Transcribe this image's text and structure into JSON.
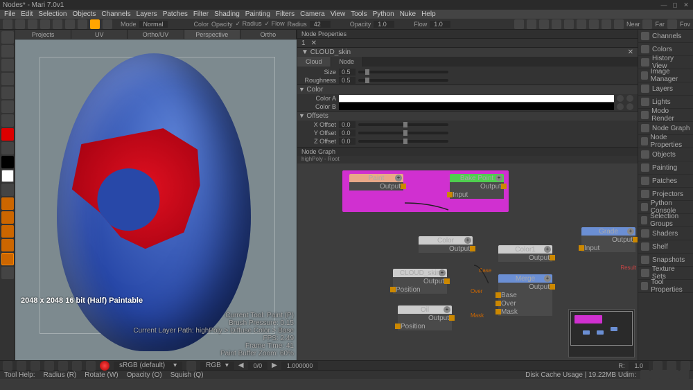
{
  "title": "Nodes* - Mari 7.0v1",
  "menu": [
    "File",
    "Edit",
    "Selection",
    "Objects",
    "Channels",
    "Layers",
    "Patches",
    "Filter",
    "Shading",
    "Painting",
    "Filters",
    "Camera",
    "View",
    "Tools",
    "Python",
    "Nuke",
    "Help"
  ],
  "toolbar": {
    "mode_lbl": "Mode",
    "mode_val": "Normal",
    "color_lbl": "Color",
    "opacity_lbl": "Opacity",
    "radius_chk": "✓ Radius",
    "flow_chk": "✓ Flow",
    "radius": "Radius",
    "radius_val": "42",
    "opacity2": "Opacity",
    "opacity2_val": "1.0",
    "flow": "Flow",
    "flow_val": "1.0",
    "near": "Near",
    "far": "Far",
    "fov": "Fov"
  },
  "viewport_tabs": [
    "Projects",
    "UV",
    "Ortho/UV",
    "Perspective",
    "Ortho"
  ],
  "viewport_tabs_active": 3,
  "viewport_overlay": "2048 x 2048 16 bit (Half) Paintable",
  "viewport_info": [
    "Current Tool: Paint (P)",
    "Brush Pressure: 0.15",
    "Current Layer Path: highPoly > Diffuse Color > Base",
    "FPS: 2.49",
    "Frame Time: 41",
    "Paint Buffer Zoom: 60%"
  ],
  "node_props": {
    "title": "Node Properties",
    "section": "CLOUD_skin",
    "tabs": [
      "Cloud",
      "Node"
    ],
    "size_lbl": "Size",
    "size_val": "0.5",
    "rough_lbl": "Roughness",
    "rough_val": "0.5",
    "color_grp": "Color",
    "colorA": "Color A",
    "colorB": "Color B",
    "offsets_grp": "Offsets",
    "xoff": "X Offset",
    "xoff_val": "0.0",
    "yoff": "Y Offset",
    "yoff_val": "0.0",
    "zoff": "Z Offset",
    "zoff_val": "0.0"
  },
  "nodegraph": {
    "title": "Node Graph",
    "path": "highPoly - Root",
    "nodes": {
      "paint": "Paint",
      "bake": "Bake Point",
      "color": "Color",
      "color1": "Color1",
      "cloud": "CLOUD_skin",
      "oil": "Oil",
      "merge": "Merge",
      "grade": "Grade",
      "output": "Output",
      "input": "Input",
      "position": "Position",
      "base": "Base",
      "over": "Over",
      "mask": "Mask",
      "result": "Result"
    }
  },
  "rpanel": [
    "Channels",
    "Colors",
    "History View",
    "Image Manager",
    "Layers",
    "Lights",
    "Modo Render",
    "Node Graph",
    "Node Properties",
    "Objects",
    "Painting",
    "Patches",
    "Projectors",
    "Python Console",
    "Selection Groups",
    "Shaders",
    "Shelf",
    "Snapshots",
    "Texture Sets",
    "Tool Properties"
  ],
  "bottombar": {
    "cs": "sRGB (default)",
    "ch": "RGB",
    "fr": "0/0",
    "zoom": "1.000000",
    "r": "1.0"
  },
  "statusbar": {
    "help": "Tool Help:",
    "radius": "Radius (R)",
    "rotate": "Rotate (W)",
    "opacity": "Opacity (O)",
    "squish": "Squish (Q)",
    "disk": "Disk Cache Usage | 19.22MB  Udim:"
  }
}
